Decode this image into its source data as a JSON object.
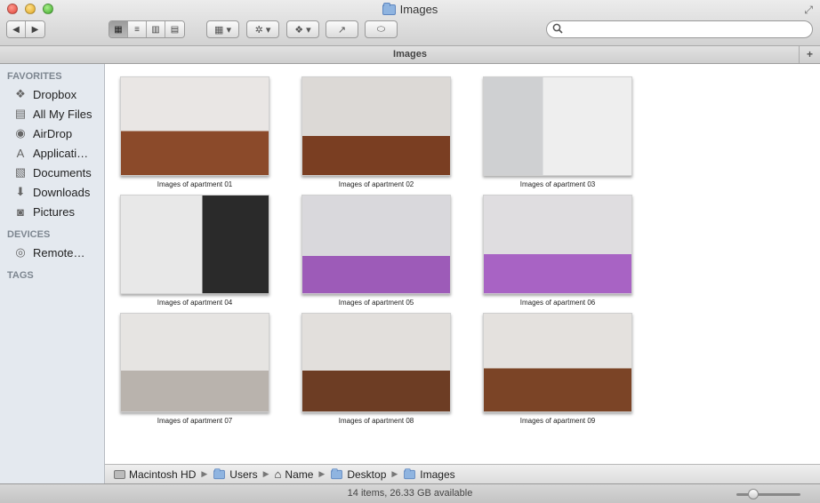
{
  "window": {
    "title": "Images"
  },
  "toolbar": {
    "back": "◀",
    "forward": "▶",
    "view_modes": [
      "▦",
      "≡",
      "▥",
      "▤"
    ],
    "arrange": "▦ ▾",
    "action": "✲ ▾",
    "dropbox": "❖ ▾",
    "share": "↗",
    "tag": "⬭",
    "search_placeholder": ""
  },
  "path_header": {
    "title": "Images",
    "new_tab": "+"
  },
  "sidebar": {
    "favorites_title": "FAVORITES",
    "favorites": [
      {
        "label": "Dropbox",
        "icon": "❖"
      },
      {
        "label": "All My Files",
        "icon": "▤"
      },
      {
        "label": "AirDrop",
        "icon": "◉"
      },
      {
        "label": "Applicati…",
        "icon": "A"
      },
      {
        "label": "Documents",
        "icon": "▧"
      },
      {
        "label": "Downloads",
        "icon": "⬇"
      },
      {
        "label": "Pictures",
        "icon": "◙"
      }
    ],
    "devices_title": "DEVICES",
    "devices": [
      {
        "label": "Remote…",
        "icon": "◎"
      }
    ],
    "tags_title": "TAGS"
  },
  "files": [
    {
      "name": "Images of apartment 01"
    },
    {
      "name": "Images of apartment 02"
    },
    {
      "name": "Images of apartment 03"
    },
    {
      "name": "Images of apartment 04"
    },
    {
      "name": "Images of apartment 05"
    },
    {
      "name": "Images of apartment 06"
    },
    {
      "name": "Images of apartment 07"
    },
    {
      "name": "Images of apartment 08"
    },
    {
      "name": "Images of apartment 09"
    }
  ],
  "pathbar": [
    "Macintosh HD",
    "Users",
    "Name",
    "Desktop",
    "Images"
  ],
  "status": {
    "text": "14 items, 26.33 GB available"
  }
}
